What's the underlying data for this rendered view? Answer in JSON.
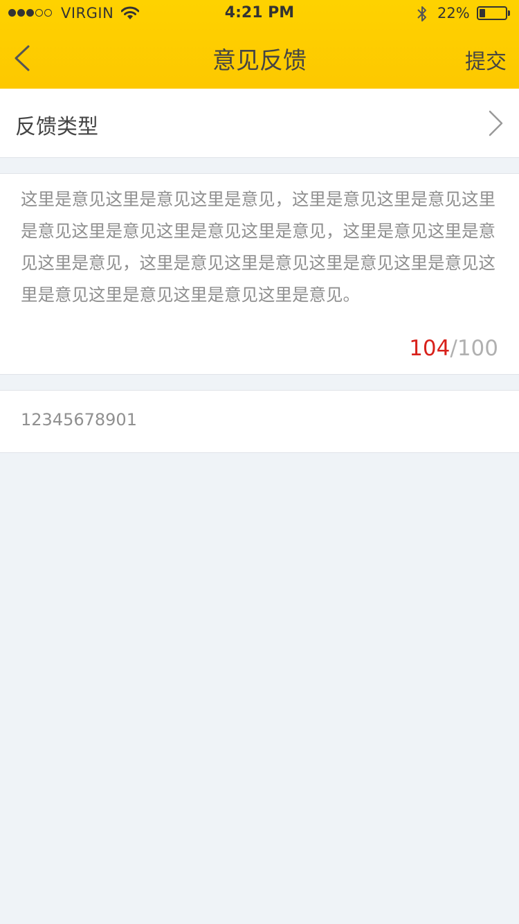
{
  "status_bar": {
    "carrier": "VIRGIN",
    "time": "4:21 PM",
    "battery_percent": "22%",
    "battery_level": 0.22,
    "signal_bars_filled": 3,
    "signal_bars_total": 5
  },
  "nav": {
    "back_icon": "chevron-left-icon",
    "title": "意见反馈",
    "submit_label": "提交"
  },
  "feedback_type": {
    "label": "反馈类型",
    "chevron_icon": "chevron-right-icon"
  },
  "feedback": {
    "text": "这里是意见这里是意见这里是意见，这里是意见这里是意见这里是意见这里是意见这里是意见这里是意见，这里是意见这里是意见这里是意见，这里是意见这里是意见这里是意见这里是意见这里是意见这里是意见这里是意见这里是意见。",
    "count": "104",
    "separator": "/",
    "max": "100"
  },
  "contact": {
    "value": "12345678901"
  },
  "colors": {
    "header_yellow": "#fed200",
    "page_background": "#eff3f7",
    "counter_over_red": "#d8211b"
  }
}
